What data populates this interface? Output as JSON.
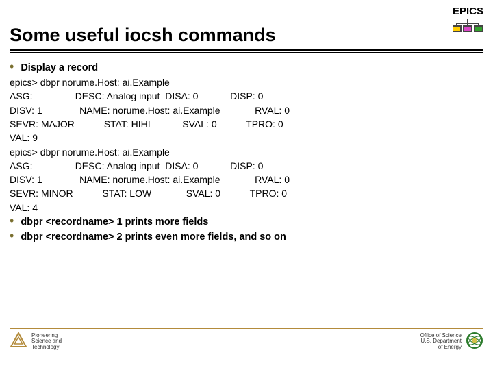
{
  "header": {
    "logo_text": "EPICS"
  },
  "title": "Some useful iocsh commands",
  "bullets": {
    "b1": "Display a record",
    "b2": "dbpr <recordname> 1 prints more fields",
    "b3": "dbpr <recordname> 2 prints even more fields, and so on"
  },
  "code": "epics> dbpr norume.Host: ai.Example\nASG:                DESC: Analog input  DISA: 0            DISP: 0\nDISV: 1              NAME: norume.Host: ai.Example             RVAL: 0\nSEVR: MAJOR           STAT: HIHI            SVAL: 0           TPRO: 0\nVAL: 9\nepics> dbpr norume.Host: ai.Example\nASG:                DESC: Analog input  DISA: 0            DISP: 0\nDISV: 1              NAME: norume.Host: ai.Example             RVAL: 0\nSEVR: MINOR           STAT: LOW             SVAL: 0           TPRO: 0\nVAL: 4",
  "footer": {
    "left_line1": "Pioneering",
    "left_line2": "Science and",
    "left_line3": "Technology",
    "right_line1": "Office of Science",
    "right_line2": "U.S. Department",
    "right_line3": "of Energy"
  }
}
